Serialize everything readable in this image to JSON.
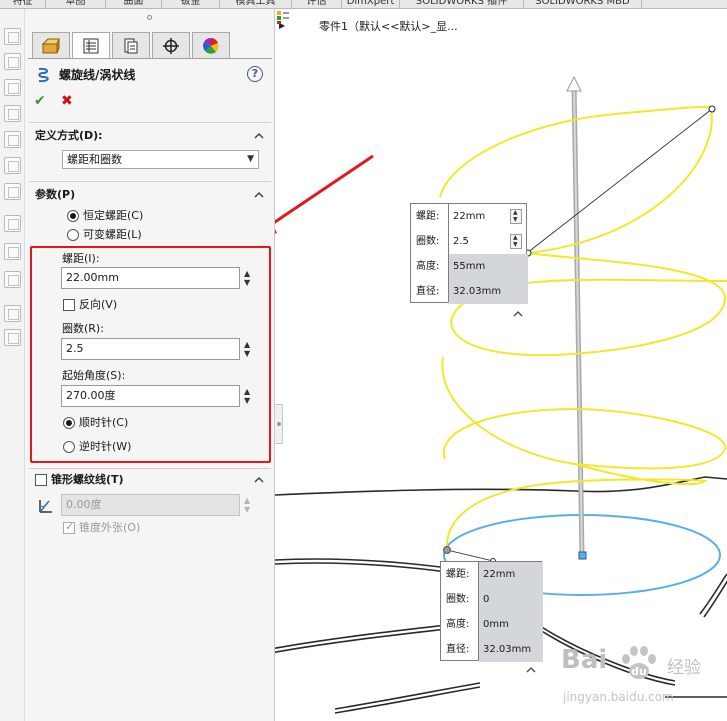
{
  "ribbon": {
    "tabs": [
      "特征",
      "草图",
      "曲面",
      "钣金",
      "模具工具",
      "评估",
      "DimXpert",
      "SOLIDWORKS 插件",
      "SOLIDWORKS MBD"
    ]
  },
  "toolstrip": {
    "icons": [
      "extrude-icon",
      "revolve-icon",
      "sweep-icon",
      "loft-icon",
      "boundary-icon",
      "hole-icon",
      "cut-icon",
      "fillet-icon",
      "pattern-icon",
      "rib-icon",
      "draft-icon",
      "shell-icon",
      "wrap-icon"
    ]
  },
  "property_manager": {
    "tabs": [
      {
        "name": "feature-manager-tab",
        "icon": "feature-tree-icon"
      },
      {
        "name": "property-manager-tab",
        "icon": "property-list-icon"
      },
      {
        "name": "configuration-manager-tab",
        "icon": "configuration-icon"
      },
      {
        "name": "dimxpert-manager-tab",
        "icon": "crosshair-icon"
      },
      {
        "name": "display-manager-tab",
        "icon": "color-wheel-icon"
      }
    ],
    "title": "螺旋线/涡状线",
    "help": "?",
    "ok_glyph": "✔",
    "cancel_glyph": "✖",
    "definition": {
      "title": "定义方式(D):",
      "value": "螺距和圈数"
    },
    "parameters": {
      "title": "参数(P)",
      "constant_pitch": "恒定螺距(C)",
      "variable_pitch": "可变螺距(L)",
      "pitch_label": "螺距(I):",
      "pitch_value": "22.00mm",
      "reverse_label": "反向(V)",
      "revolutions_label": "圈数(R):",
      "revolutions_value": "2.5",
      "start_angle_label": "起始角度(S):",
      "start_angle_value": "270.00度",
      "clockwise": "顺时针(C)",
      "counterclockwise": "逆时针(W)"
    },
    "taper": {
      "title": "锥形螺纹线(T)",
      "angle_value": "0.00度",
      "taper_outward": "锥度外张(O)"
    },
    "highlight_color": "#e01a1a"
  },
  "graphics": {
    "tree_label": "零件1（默认<<默认>_显...",
    "callout_top": {
      "rows": [
        {
          "key": "螺距:",
          "value": "22mm"
        },
        {
          "key": "圈数:",
          "value": "2.5"
        },
        {
          "key": "高度:",
          "value": "55mm"
        },
        {
          "key": "直径:",
          "value": "32.03mm"
        }
      ]
    },
    "callout_bottom": {
      "rows": [
        {
          "key": "螺距:",
          "value": "22mm"
        },
        {
          "key": "圈数:",
          "value": "0"
        },
        {
          "key": "高度:",
          "value": "0mm"
        },
        {
          "key": "直径:",
          "value": "32.03mm"
        }
      ]
    },
    "helix_color": "#f2e82a",
    "base_circle_color": "#5aaee8",
    "axis_color": "#b4b4b4"
  },
  "watermark": {
    "brand": "Bai",
    "brand_cn": "经验",
    "url": "jingyan.baidu.com"
  }
}
